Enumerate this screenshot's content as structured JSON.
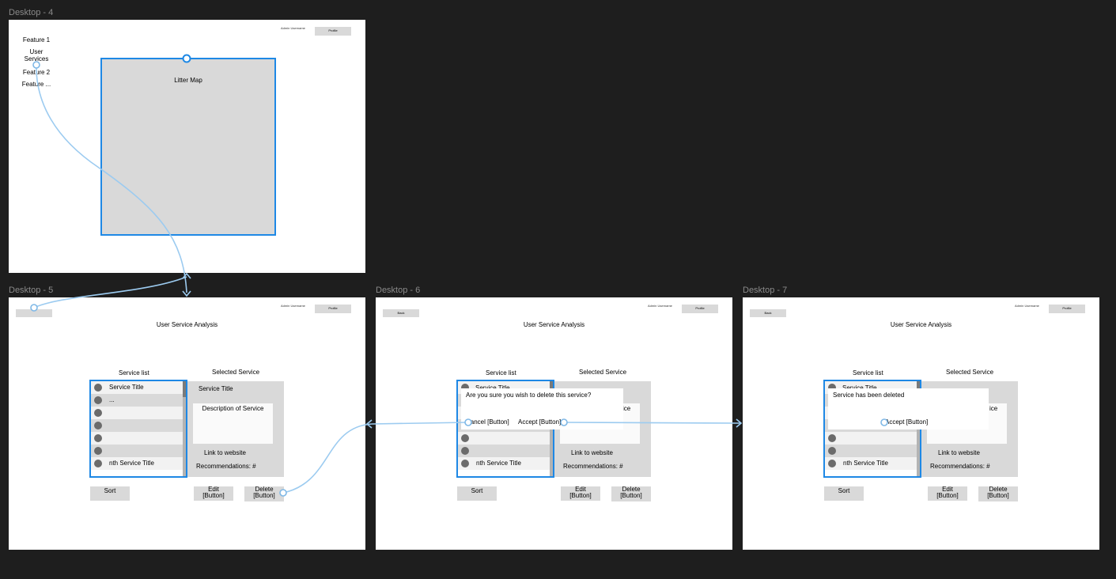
{
  "frames": {
    "d4": {
      "label": "Desktop - 4"
    },
    "d5": {
      "label": "Desktop - 5"
    },
    "d6": {
      "label": "Desktop - 6"
    },
    "d7": {
      "label": "Desktop - 7"
    }
  },
  "header": {
    "admin_username": "Admin Username",
    "profile": "Profile",
    "back": "Back"
  },
  "d4": {
    "features": [
      "Feature 1",
      "User\nServices",
      "Feature 2",
      "Feature ..."
    ],
    "map_label": "Litter Map"
  },
  "analysis": {
    "title": "User Service Analysis",
    "service_list_heading": "Service list",
    "selected_service_heading": "Selected Service",
    "rows": [
      "Service Title",
      "...",
      "",
      "",
      "",
      "",
      "nth Service Title"
    ],
    "selected_title": "Service Title",
    "description": "Description of Service",
    "link": "Link to website",
    "recommendations": "Recommendations: #",
    "sort": "Sort",
    "edit": "Edit\n[Button]",
    "delete": "Delete\n[Button]"
  },
  "d6": {
    "dialog_text": "Are you sure you wish to delete this service?",
    "cancel": "Cancel [Button]",
    "accept": "Accept [Button]",
    "partial_title": "Service Title",
    "partial_desc": "ice"
  },
  "d7": {
    "dialog_text": "Service has been deleted",
    "accept": "Accept [Button]",
    "partial_title": "Service Title",
    "partial_desc": "ice"
  },
  "colors": {
    "canvas": "#1e1e1e",
    "frame": "#ffffff",
    "gray": "#d9d9d9",
    "selection": "#1e88e5",
    "prototype_wire": "#9ccbf0"
  }
}
